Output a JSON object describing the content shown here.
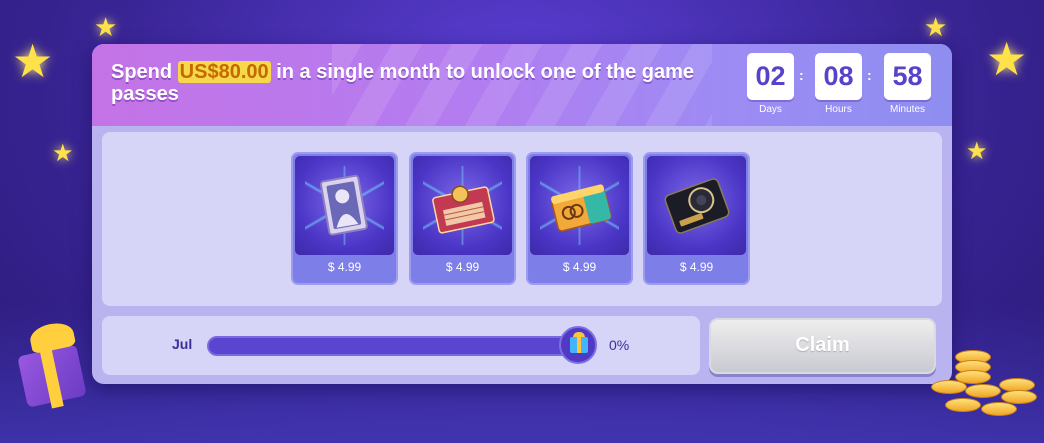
{
  "promo": {
    "headline_prefix": "Spend ",
    "amount": "US$80.00",
    "headline_suffix": " in a single month to unlock one of the game passes"
  },
  "countdown": {
    "days": {
      "value": "02",
      "label": "Days"
    },
    "hours": {
      "value": "08",
      "label": "Hours"
    },
    "minutes": {
      "value": "58",
      "label": "Minutes"
    }
  },
  "passes": [
    {
      "icon": "card-icon",
      "price": "$ 4.99"
    },
    {
      "icon": "ticket-icon",
      "price": "$ 4.99"
    },
    {
      "icon": "chest-icon",
      "price": "$ 4.99"
    },
    {
      "icon": "device-icon",
      "price": "$ 4.99"
    }
  ],
  "progress": {
    "month": "Jul",
    "percent_text": "0%",
    "fill_fraction": 1.0,
    "milestone_icon": "gift-icon"
  },
  "claim_button": {
    "label": "Claim",
    "enabled": false
  },
  "colors": {
    "accent": "#5842c9",
    "amount_highlight": "#f7d84a",
    "background": "#3a2596"
  }
}
